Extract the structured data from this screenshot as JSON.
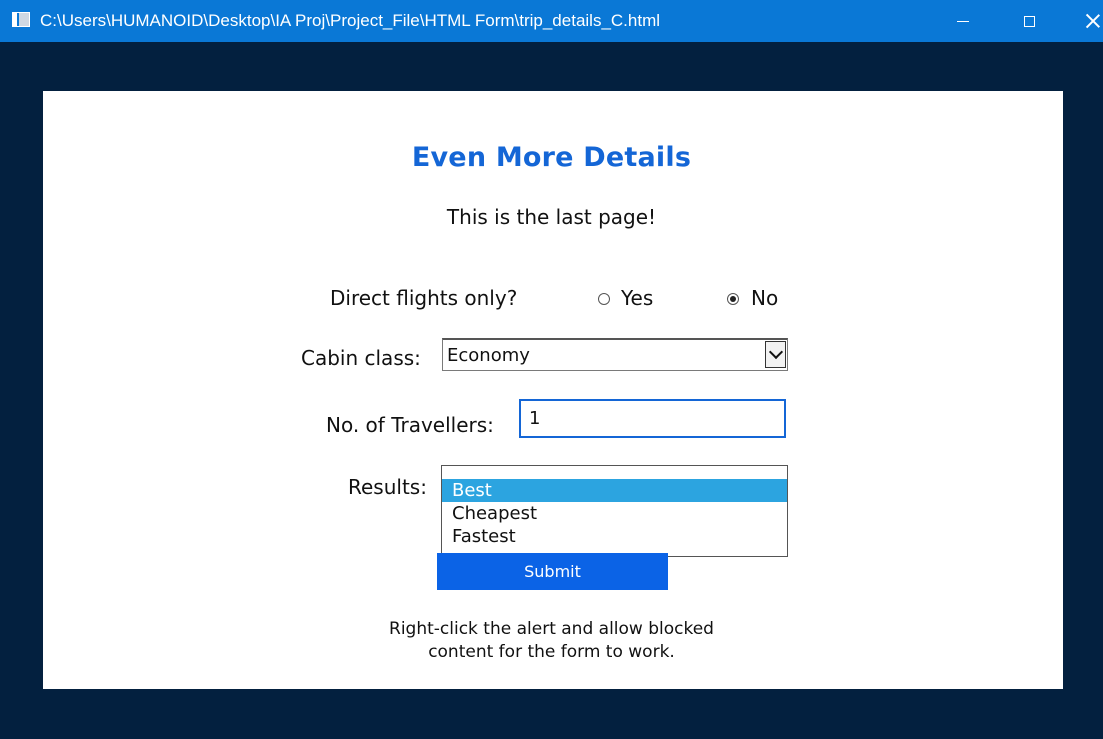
{
  "window": {
    "title": "C:\\Users\\HUMANOID\\Desktop\\IA Proj\\Project_File\\HTML Form\\trip_details_C.html",
    "icon": "app-window-icon",
    "controls": [
      "minimize-icon",
      "maximize-icon",
      "close-icon"
    ]
  },
  "page": {
    "heading": "Even More Details",
    "subheading": "This is the last page!",
    "colors": {
      "heading": "#1466d6",
      "submit_background": "#0b63e6",
      "selected_option": "#2ca4e0",
      "window_background": "#03203f",
      "titlebar": "#0a78d6"
    }
  },
  "form": {
    "direct_flights": {
      "label": "Direct flights only?",
      "options": [
        {
          "label": "Yes",
          "checked": false
        },
        {
          "label": "No",
          "checked": true
        }
      ]
    },
    "cabin_class": {
      "label": "Cabin class:",
      "value": "Economy"
    },
    "travellers": {
      "label": "No. of Travellers:",
      "value": "1"
    },
    "results": {
      "label": "Results:",
      "options": [
        "Best",
        "Cheapest",
        "Fastest"
      ],
      "selected": "Best"
    },
    "submit_label": "Submit"
  },
  "note": {
    "line1": "Right-click the alert and allow blocked",
    "line2": "content for the form to work."
  }
}
